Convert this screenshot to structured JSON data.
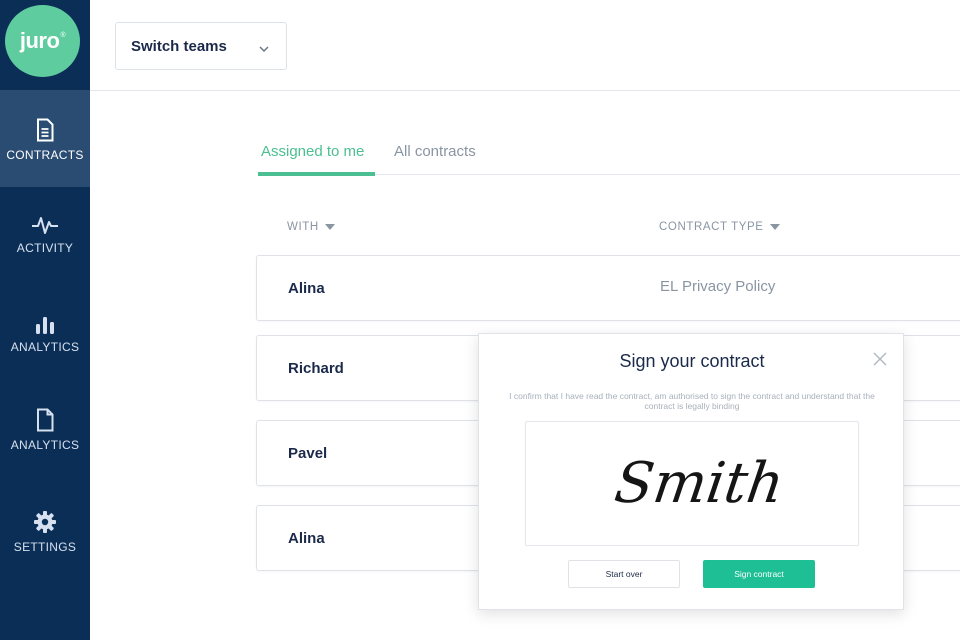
{
  "sidebar": {
    "logo": "juro",
    "logo_mark": "®",
    "items": [
      {
        "label": "CONTRACTS",
        "icon": "document-icon",
        "active": true
      },
      {
        "label": "ACTIVITY",
        "icon": "pulse-icon",
        "active": false
      },
      {
        "label": "ANALYTICS",
        "icon": "bar-chart-icon",
        "active": false
      },
      {
        "label": "ANALYTICS",
        "icon": "file-icon",
        "active": false
      },
      {
        "label": "SETTINGS",
        "icon": "gear-icon",
        "active": false
      }
    ]
  },
  "header": {
    "team_select": "Switch teams"
  },
  "tabs": [
    {
      "label": "Assigned to me",
      "active": true
    },
    {
      "label": "All contracts",
      "active": false
    }
  ],
  "table": {
    "columns": [
      "WITH",
      "CONTRACT TYPE"
    ],
    "rows": [
      {
        "with": "Alina",
        "type": "EL Privacy Policy"
      },
      {
        "with": "Richard",
        "type": ""
      },
      {
        "with": "Pavel",
        "type": ""
      },
      {
        "with": "Alina",
        "type": ""
      }
    ]
  },
  "modal": {
    "title": "Sign your contract",
    "confirmation": "I confirm that I have read the contract, am authorised to sign the contract and understand that the contract is legally binding",
    "signature": "Smith",
    "start_over": "Start over",
    "sign": "Sign contract"
  },
  "colors": {
    "sidebar": "#0b2e57",
    "sidebar_active": "#2a4c73",
    "accent": "#4cbf92",
    "logo": "#5fcca0",
    "sign_button": "#1fbf95"
  }
}
